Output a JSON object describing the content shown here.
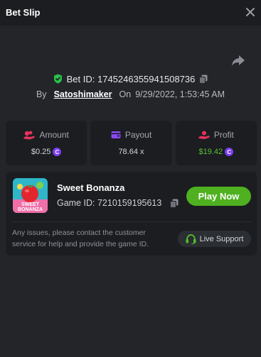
{
  "header": {
    "title": "Bet Slip"
  },
  "bet": {
    "id_label": "Bet ID: 1745246355941508736",
    "by_label": "By",
    "user": "Satoshimaker",
    "on_label": "On",
    "datetime": "9/29/2022, 1:53:45 AM"
  },
  "stats": [
    {
      "label": "Amount",
      "value": "$0.25",
      "icon": "coins-hand-icon",
      "color": "#e8335a"
    },
    {
      "label": "Payout",
      "value": "78.64 x",
      "icon": "wallet-icon",
      "color": "#8b49f7"
    },
    {
      "label": "Profit",
      "value": "$19.42",
      "icon": "money-hand-icon",
      "color": "#e8335a",
      "value_color": "#59c134"
    }
  ],
  "game": {
    "name": "Sweet Bonanza",
    "id_label": "Game ID: 7210159195613",
    "play_label": "Play Now",
    "thumb_text_1": "SWEET",
    "thumb_text_2": "BONANZA"
  },
  "notice": "Any issues, please contact the customer service for help and provide the game ID.",
  "support": {
    "label": "Live Support",
    "icon": "headset-icon"
  },
  "colors": {
    "accent_green": "#4fb020",
    "coin_purple": "#7b3df2",
    "background": "#232529",
    "card": "#1b1d21"
  }
}
